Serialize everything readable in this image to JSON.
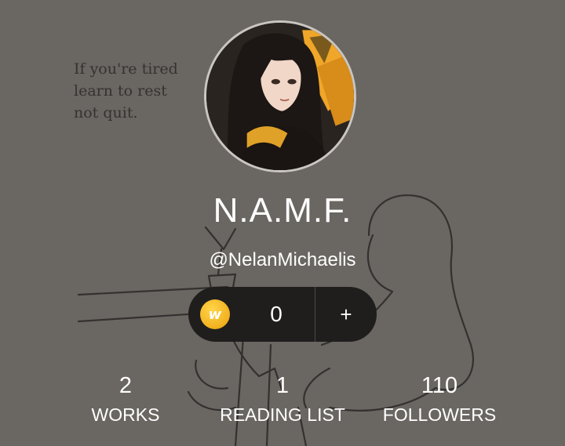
{
  "quote": {
    "lines": [
      "If you're tired",
      "learn to rest",
      "not quit."
    ]
  },
  "profile": {
    "display_name": "N.A.M.F.",
    "handle": "@NelanMichaelis"
  },
  "coins": {
    "icon": "wattpad-coin-icon",
    "icon_letter": "w",
    "count": "0",
    "add_label": "+"
  },
  "stats": [
    {
      "value": "2",
      "label": "WORKS"
    },
    {
      "value": "1",
      "label": "READING LIST"
    },
    {
      "value": "110",
      "label": "FOLLOWERS"
    }
  ],
  "colors": {
    "background": "#6a6662",
    "pill": "#1f1e1d",
    "coin": "#f2b01e",
    "text": "#ffffff"
  }
}
